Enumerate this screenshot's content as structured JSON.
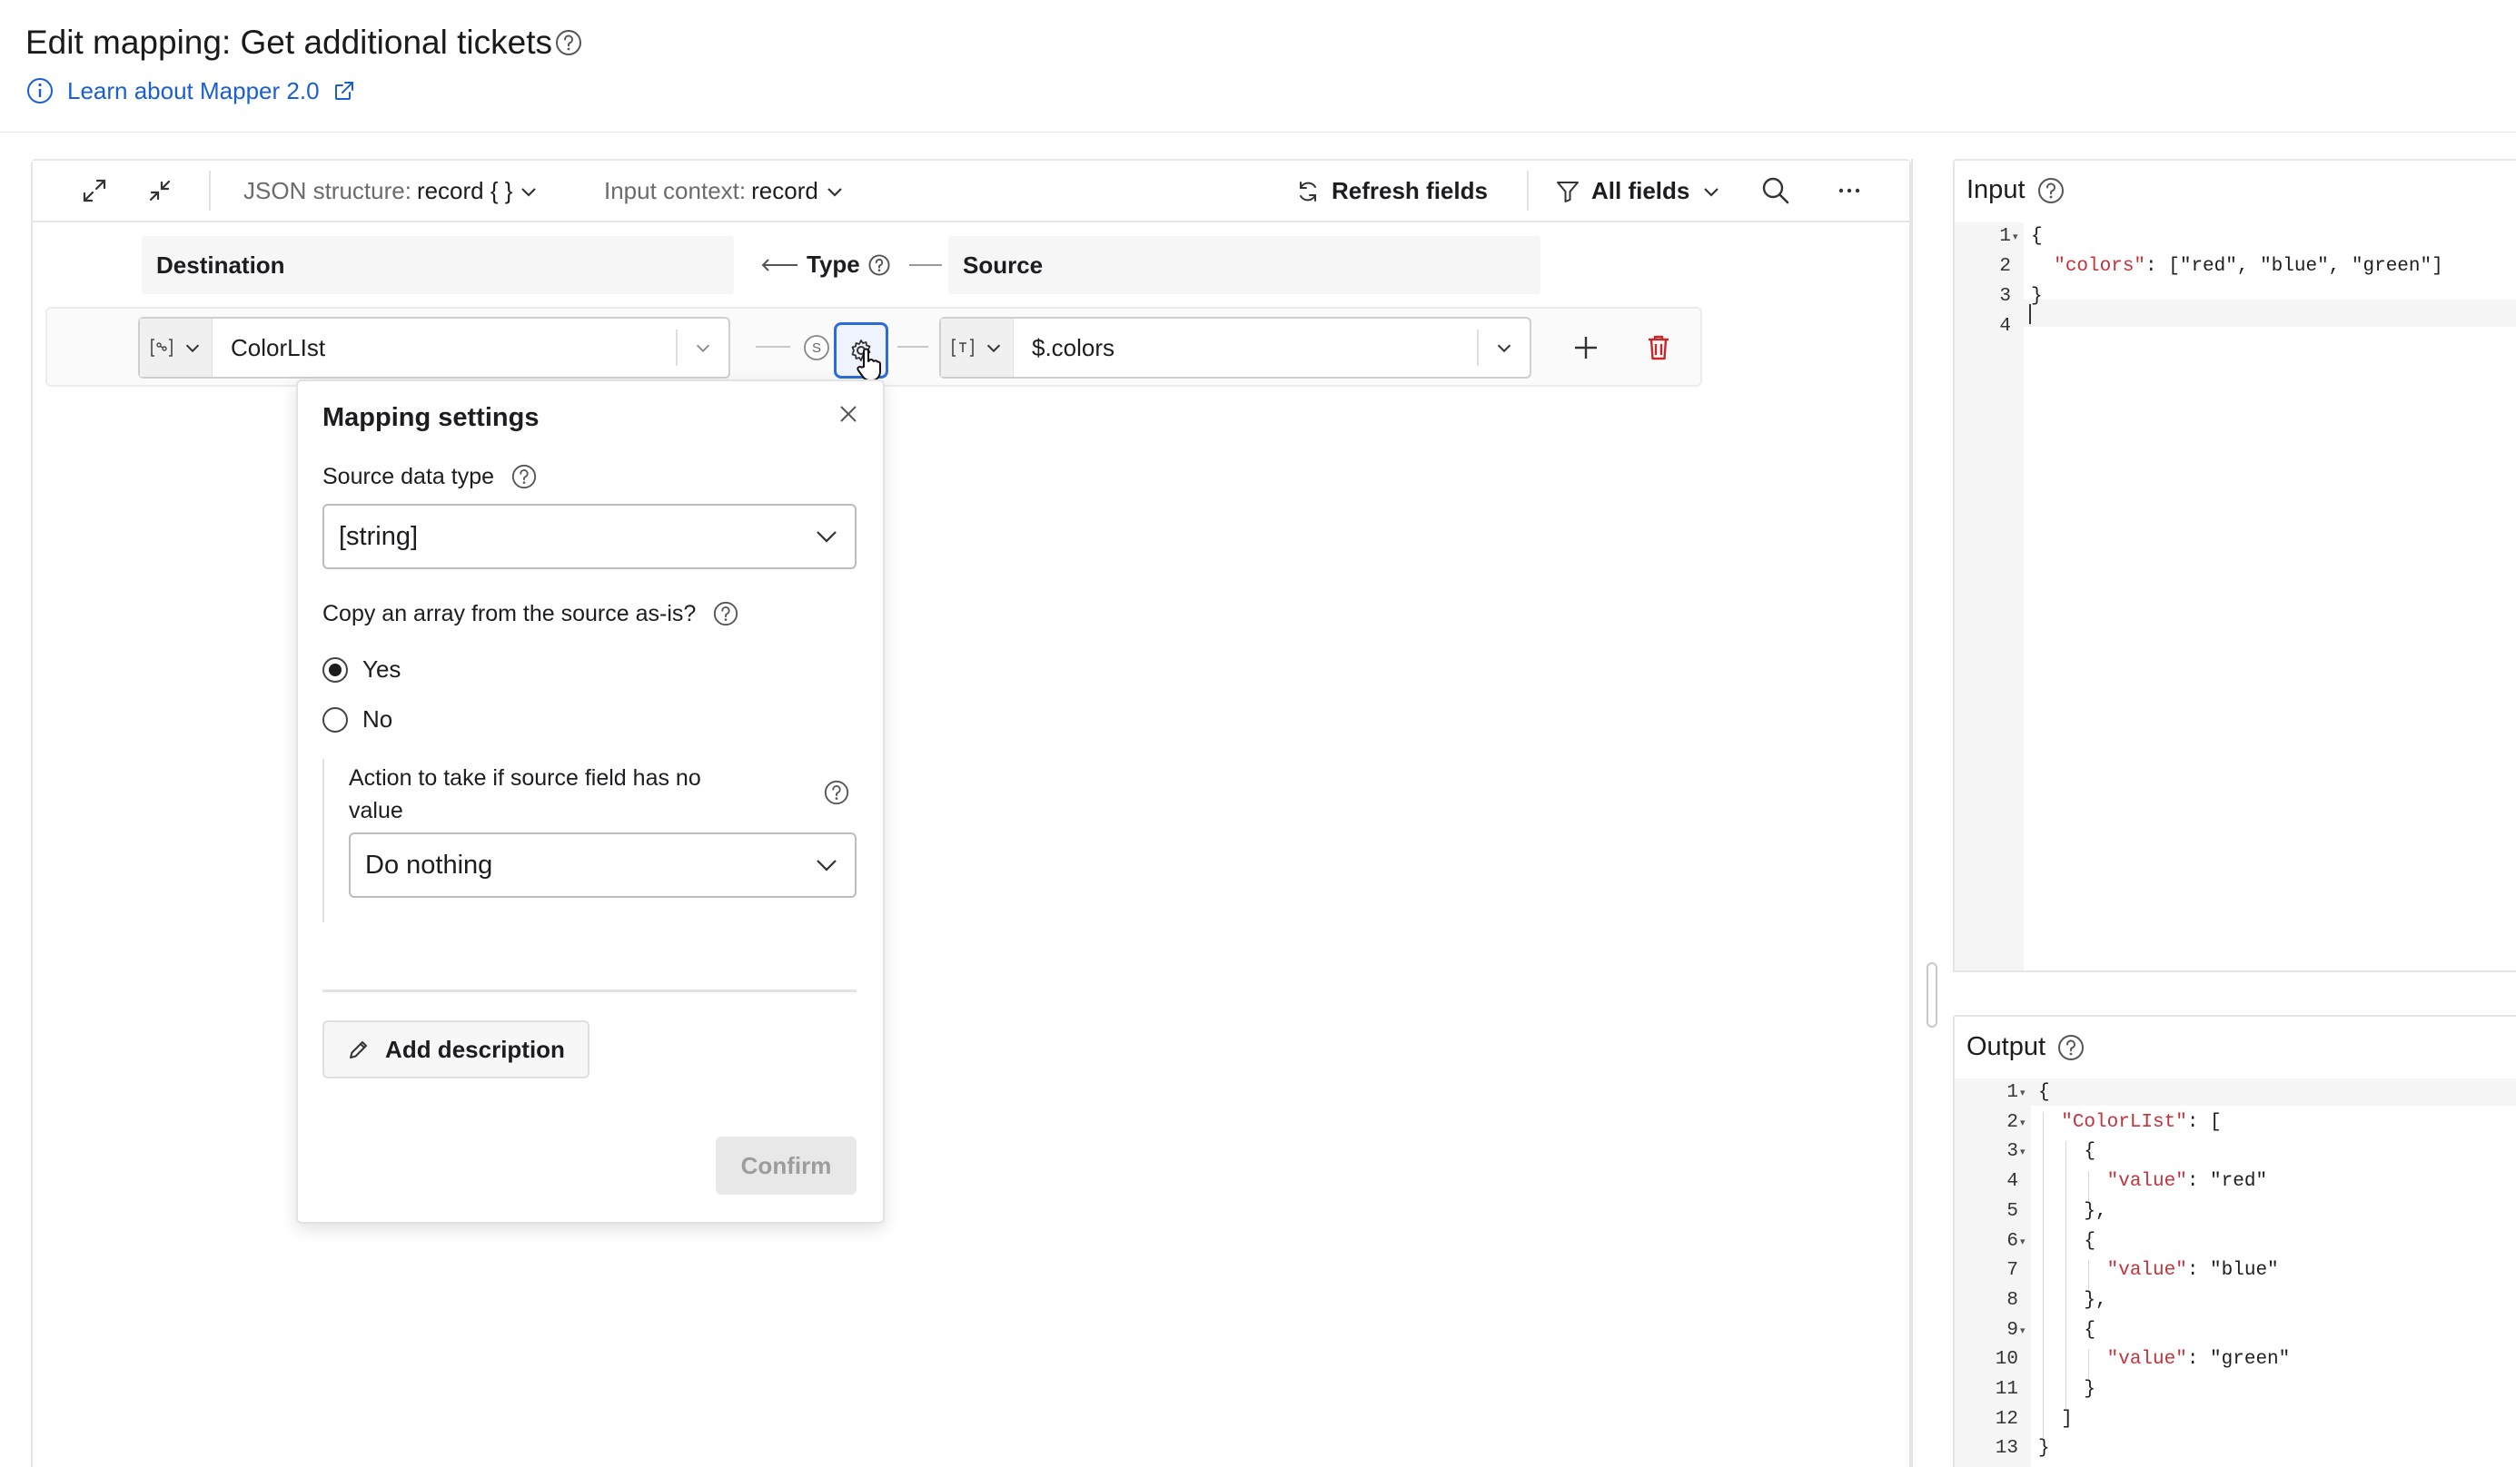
{
  "header": {
    "title": "Edit mapping: Get additional tickets",
    "learn_link": "Learn about Mapper 2.0"
  },
  "toolbar": {
    "json_structure_label": "JSON structure:",
    "json_structure_value": "record { }",
    "input_context_label": "Input context:",
    "input_context_value": "record",
    "refresh_label": "Refresh fields",
    "filter_label": "All fields"
  },
  "columns": {
    "destination": "Destination",
    "type": "Type",
    "source": "Source"
  },
  "mapping_row": {
    "destination_field": "ColorLIst",
    "source_field": "$.colors"
  },
  "popover": {
    "title": "Mapping settings",
    "source_type_label": "Source data type",
    "source_type_value": "[string]",
    "copy_array_label": "Copy an array from the source as-is?",
    "radio_yes": "Yes",
    "radio_no": "No",
    "selected": "Yes",
    "no_value_label_line1": "Action to take if source field has no",
    "no_value_label_line2": "value",
    "no_value_action": "Do nothing",
    "add_description": "Add description",
    "confirm": "Confirm"
  },
  "input_panel": {
    "title": "Input",
    "line_numbers": [
      "1",
      "2",
      "3",
      "4"
    ],
    "lines": [
      {
        "pre": "{",
        "key": "",
        "post": ""
      },
      {
        "pre": "  ",
        "key": "\"colors\"",
        "post": ": [\"red\", \"blue\", \"green\"]"
      },
      {
        "pre": "}",
        "key": "",
        "post": ""
      },
      {
        "pre": "",
        "key": "",
        "post": ""
      }
    ]
  },
  "output_panel": {
    "title": "Output",
    "line_numbers": [
      "1",
      "2",
      "3",
      "4",
      "5",
      "6",
      "7",
      "8",
      "9",
      "10",
      "11",
      "12",
      "13"
    ],
    "lines": [
      {
        "pre": "{",
        "key": "",
        "post": ""
      },
      {
        "pre": "  ",
        "key": "\"ColorLIst\"",
        "post": ": ["
      },
      {
        "pre": "    {",
        "key": "",
        "post": ""
      },
      {
        "pre": "      ",
        "key": "\"value\"",
        "post": ": \"red\""
      },
      {
        "pre": "    },",
        "key": "",
        "post": ""
      },
      {
        "pre": "    {",
        "key": "",
        "post": ""
      },
      {
        "pre": "      ",
        "key": "\"value\"",
        "post": ": \"blue\""
      },
      {
        "pre": "    },",
        "key": "",
        "post": ""
      },
      {
        "pre": "    {",
        "key": "",
        "post": ""
      },
      {
        "pre": "      ",
        "key": "\"value\"",
        "post": ": \"green\""
      },
      {
        "pre": "    }",
        "key": "",
        "post": ""
      },
      {
        "pre": "  ]",
        "key": "",
        "post": ""
      },
      {
        "pre": "}",
        "key": "",
        "post": ""
      }
    ]
  },
  "colors": {
    "link": "#1a5fd0",
    "json_key": "#c4323a",
    "delete": "#c62828",
    "focus": "#2b6cd8"
  }
}
